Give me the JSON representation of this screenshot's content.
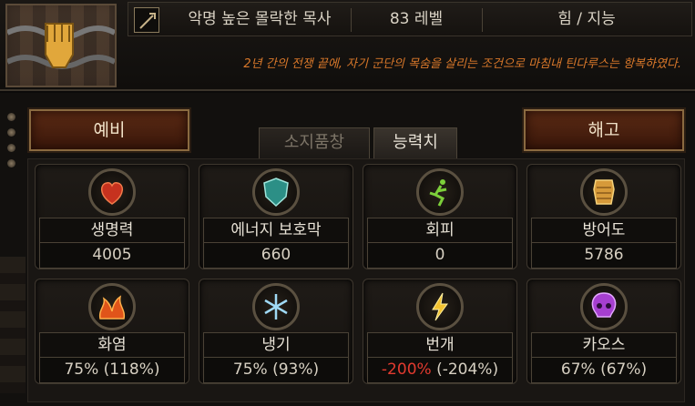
{
  "header": {
    "name": "악명 높은 몰락한 목사",
    "level": "83 레벨",
    "attributes": "힘 / 지능",
    "flavor": "2년 간의 전쟁 끝에, 자기 군단의 목숨을 살리는 조건으로 마침내 틴다루스는 항복하였다."
  },
  "buttons": {
    "reserve": "예비",
    "dismiss": "해고"
  },
  "tabs": {
    "inventory": "소지품창",
    "stats": "능력치"
  },
  "stats": [
    {
      "label": "생명력",
      "value": "4005",
      "icon": "heart-icon"
    },
    {
      "label": "에너지 보호막",
      "value": "660",
      "icon": "shield-icon"
    },
    {
      "label": "회피",
      "value": "0",
      "icon": "evasion-icon"
    },
    {
      "label": "방어도",
      "value": "5786",
      "icon": "armour-icon"
    },
    {
      "label": "화염",
      "value": "75% (118%)",
      "icon": "fire-icon"
    },
    {
      "label": "냉기",
      "value": "75% (93%)",
      "icon": "snowflake-icon"
    },
    {
      "label": "번개",
      "value_main": "-200%",
      "value_rest": " (-204%)",
      "icon": "lightning-icon"
    },
    {
      "label": "카오스",
      "value": "67% (67%)",
      "icon": "skull-icon"
    }
  ],
  "colors": {
    "accent": "#d9782a",
    "negative": "#e23a2f",
    "button": "#5a2a14"
  }
}
